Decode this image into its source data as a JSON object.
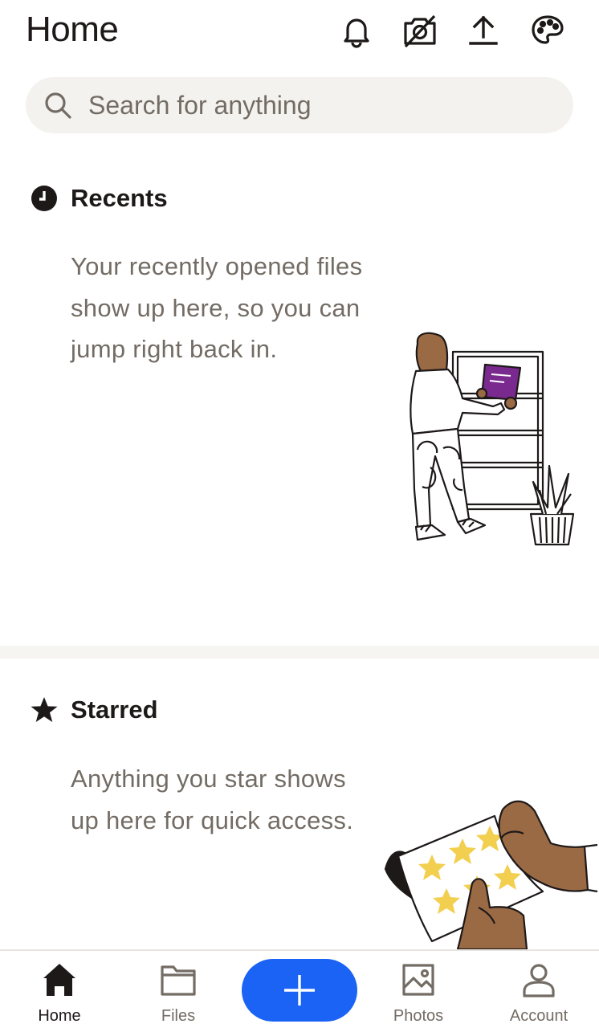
{
  "header": {
    "title": "Home",
    "icons": [
      "bell-icon",
      "camera-off-icon",
      "upload-icon",
      "palette-icon"
    ]
  },
  "search": {
    "placeholder": "Search for anything",
    "value": ""
  },
  "sections": [
    {
      "icon": "clock-icon",
      "title": "Recents",
      "description": "Your recently opened files show up here, so you can jump right back in."
    },
    {
      "icon": "star-icon",
      "title": "Starred",
      "description": "Anything you star shows up here for quick access."
    }
  ],
  "bottom_nav": {
    "items": [
      {
        "label": "Home",
        "icon": "home-icon",
        "active": true
      },
      {
        "label": "Files",
        "icon": "folder-icon",
        "active": false
      },
      {
        "label": "",
        "icon": "plus-icon",
        "active": false
      },
      {
        "label": "Photos",
        "icon": "photo-icon",
        "active": false
      },
      {
        "label": "Account",
        "icon": "person-icon",
        "active": false
      }
    ]
  },
  "colors": {
    "accent": "#1b63f5",
    "text": "#1e1919",
    "muted": "#736c64",
    "search_bg": "#f4f2ee",
    "book": "#7a2a8f",
    "star": "#f2cf4f",
    "skin": "#9a6a44"
  }
}
